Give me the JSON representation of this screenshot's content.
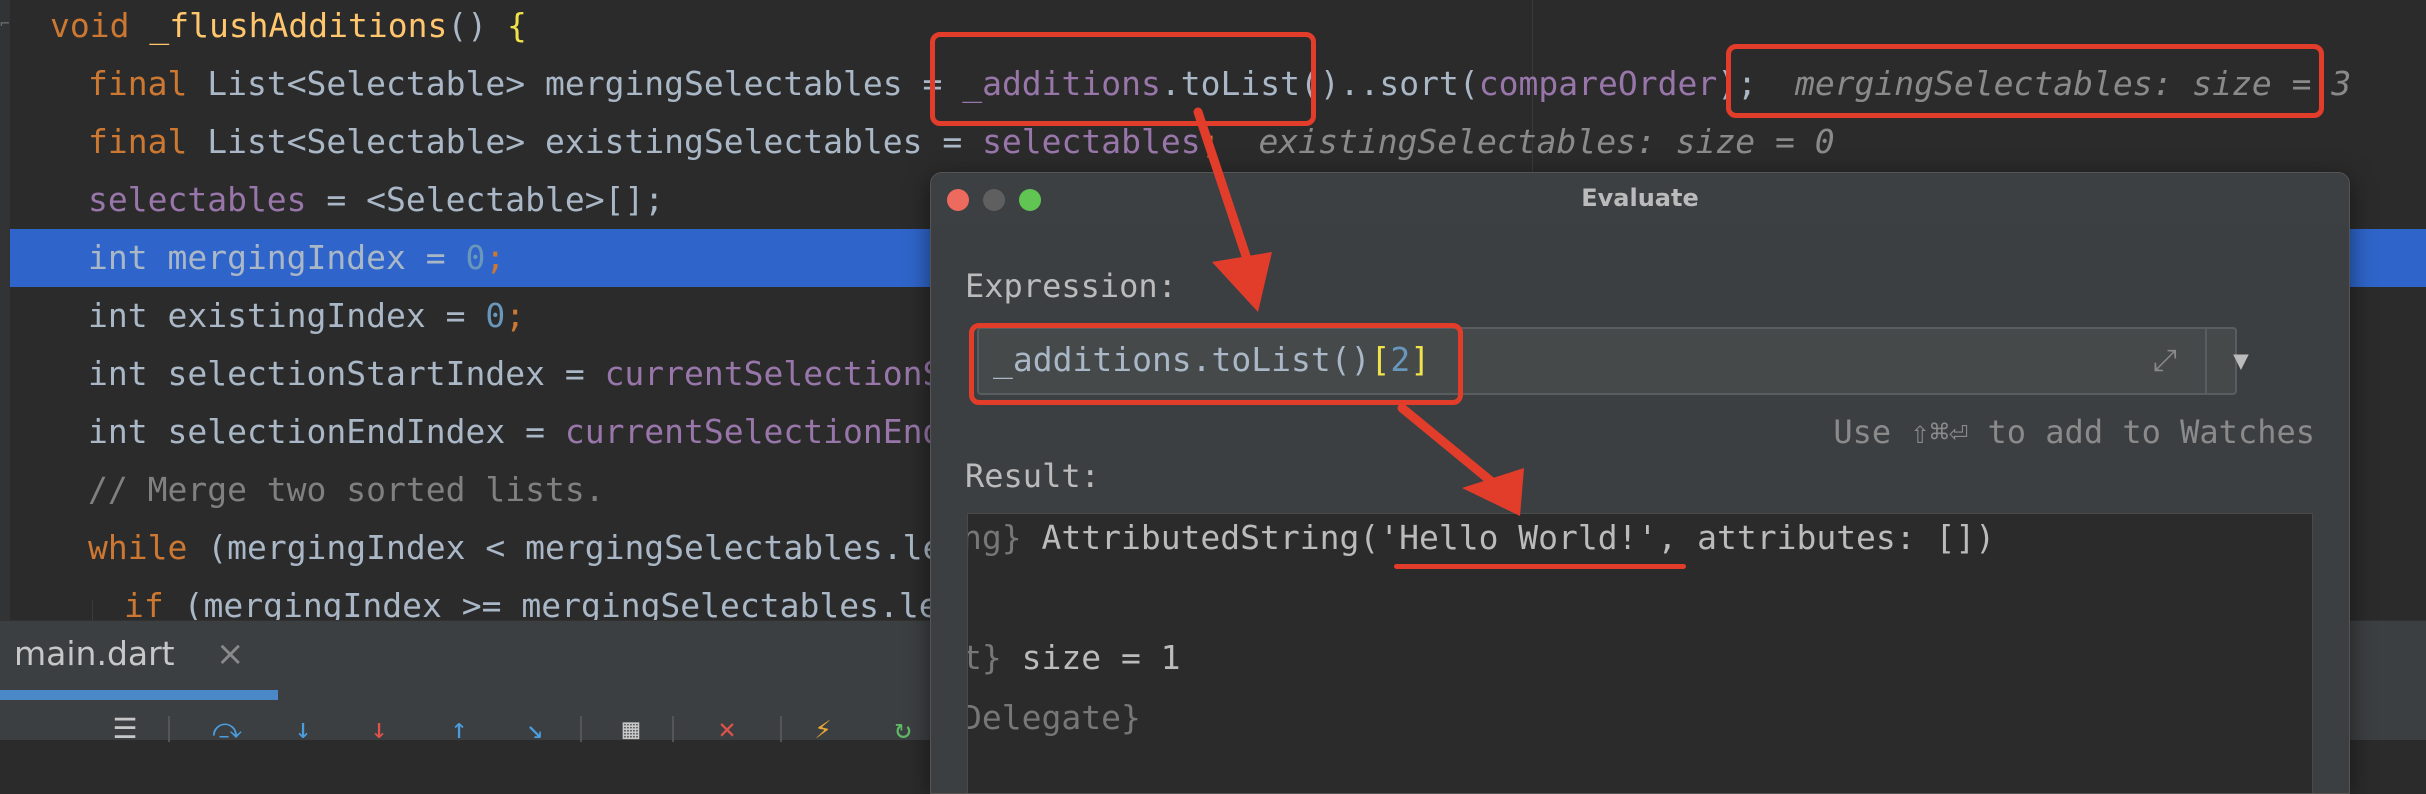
{
  "editor": {
    "lines": [
      {
        "segments": [
          [
            "kw",
            "void "
          ],
          [
            "fn",
            "_flushAdditions"
          ],
          [
            "pu",
            "() "
          ],
          [
            "brace",
            "{"
          ]
        ]
      },
      {
        "segments": [
          [
            "kw",
            "final "
          ],
          [
            "ty",
            "List<Selectable> mergingSelectables = "
          ],
          [
            "fld",
            "_additions"
          ],
          [
            "pu",
            ".toList()..sort("
          ],
          [
            "fld",
            "compareOrder"
          ],
          [
            "pu",
            ");"
          ]
        ],
        "hint": "mergingSelectables: size = 3"
      },
      {
        "segments": [
          [
            "kw",
            "final "
          ],
          [
            "ty",
            "List<Selectable> existingSelectables = "
          ],
          [
            "fld",
            "selectables"
          ],
          [
            "kw",
            ";"
          ]
        ],
        "hint": "existingSelectables: size = 0"
      },
      {
        "segments": [
          [
            "fld",
            "selectables"
          ],
          [
            "pu",
            " = <Selectable>[];"
          ]
        ]
      },
      {
        "segments": [
          [
            "ty",
            "int mergingIndex = "
          ],
          [
            "num",
            "0"
          ],
          [
            "kw",
            ";"
          ]
        ],
        "highlighted": true
      },
      {
        "segments": [
          [
            "ty",
            "int existingIndex = "
          ],
          [
            "num",
            "0"
          ],
          [
            "kw",
            ";"
          ]
        ]
      },
      {
        "segments": [
          [
            "ty",
            "int selectionStartIndex = "
          ],
          [
            "fld",
            "currentSelectionSt"
          ]
        ]
      },
      {
        "segments": [
          [
            "ty",
            "int selectionEndIndex = "
          ],
          [
            "fld",
            "currentSelectionEndI"
          ]
        ]
      },
      {
        "segments": [
          [
            "cm",
            "// Merge two sorted lists."
          ]
        ]
      },
      {
        "segments": [
          [
            "kw",
            "while "
          ],
          [
            "pu",
            "(mergingIndex < mergingSelectables.ler"
          ]
        ]
      },
      {
        "segments": [
          [
            "kw",
            "if "
          ],
          [
            "pu",
            "(mergingIndex >= mergingSelectables.ler"
          ]
        ]
      }
    ]
  },
  "tab": {
    "label": "main.dart",
    "close": "×"
  },
  "toolbar": {
    "icons": [
      {
        "name": "list-icon",
        "glyph": "☰",
        "color": "#c7c7c7"
      },
      {
        "name": "step-over-icon",
        "glyph": "⤼",
        "color": "#4a9ddf"
      },
      {
        "name": "step-into-icon",
        "glyph": "↓",
        "color": "#4a9ddf"
      },
      {
        "name": "force-step-into-icon",
        "glyph": "↓",
        "color": "#e0524a"
      },
      {
        "name": "step-out-icon",
        "glyph": "↑",
        "color": "#4a9ddf"
      },
      {
        "name": "run-to-cursor-icon",
        "glyph": "↘",
        "color": "#4a9ddf"
      },
      {
        "name": "evaluate-icon",
        "glyph": "▦",
        "color": "#c7c7c7"
      },
      {
        "name": "mute-breakpoints-icon",
        "glyph": "✕",
        "color": "#e0524a"
      },
      {
        "name": "lightning-icon",
        "glyph": "⚡",
        "color": "#e8a935"
      },
      {
        "name": "restart-icon",
        "glyph": "↻",
        "color": "#5fb865"
      }
    ]
  },
  "dialog": {
    "title": "Evaluate",
    "expression_label": "Expression:",
    "expression_value": {
      "prefix": "_additions.toList()",
      "open": "[",
      "index": "2",
      "close": "]"
    },
    "watch_hint": "Use ⇧⌘⏎ to add to Watches",
    "result_label": "Result:",
    "result_lines": [
      {
        "prefix": "ng} ",
        "text": "AttributedString('Hello World!', attributes: [])"
      },
      {
        "prefix": "t} ",
        "text": "size = 1"
      },
      {
        "prefix": "Delegate}",
        "text": ""
      }
    ],
    "colors": {
      "close": "#ed6a5e",
      "minimize": "#5f5f5f",
      "zoom": "#61c554"
    }
  },
  "annotations": {
    "color": "#e23c2b"
  }
}
